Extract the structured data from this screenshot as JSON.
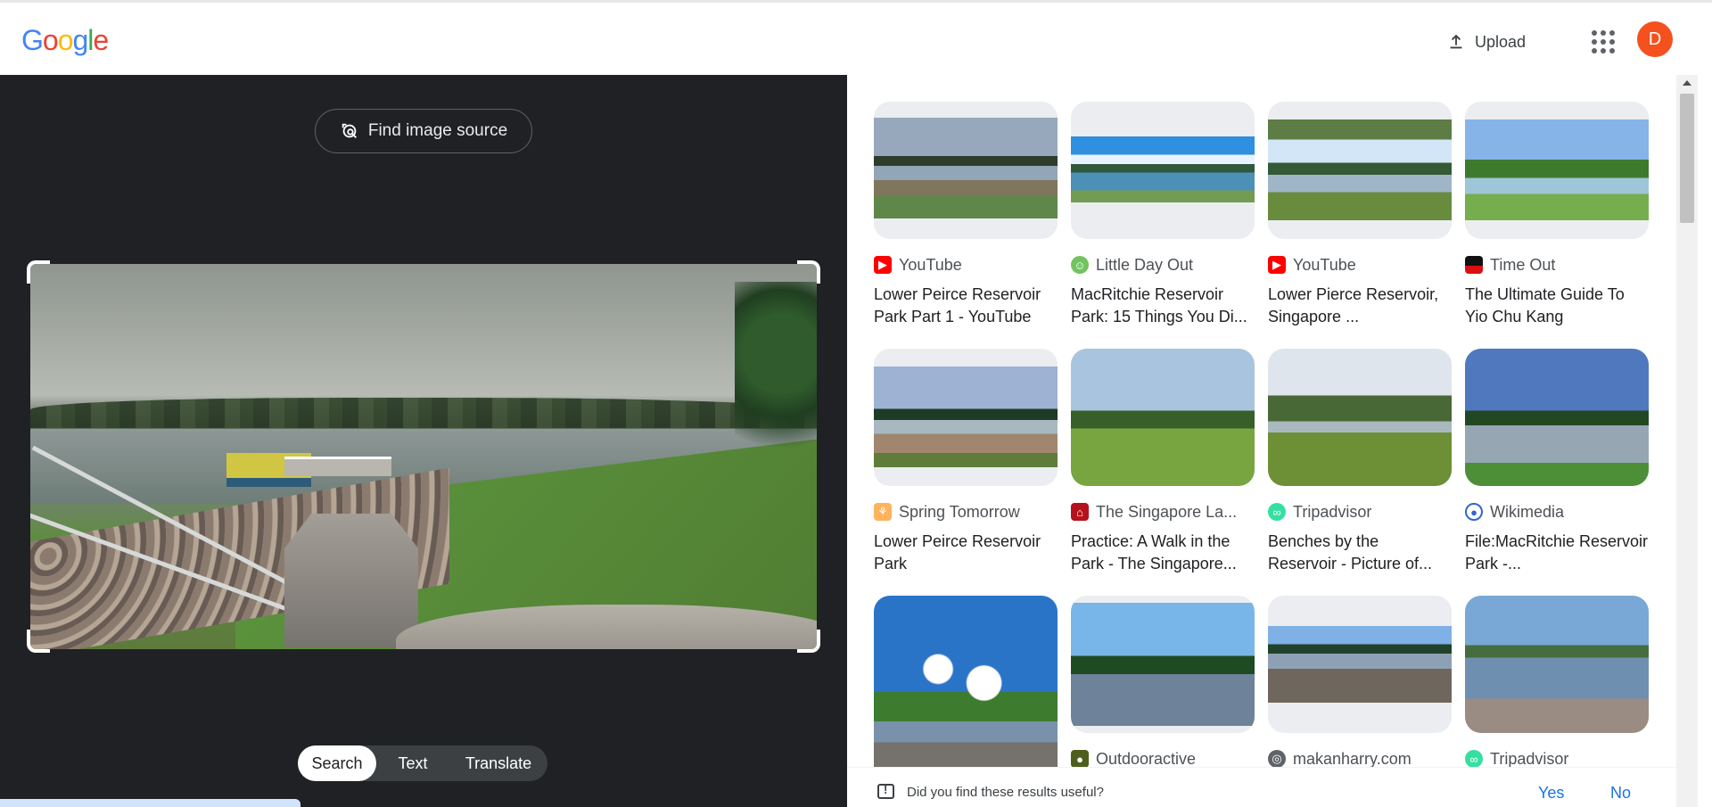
{
  "header": {
    "logo": "Google",
    "upload_label": "Upload",
    "avatar_initial": "D",
    "icons": {
      "upload": "upload-icon",
      "apps": "apps-grid-icon"
    }
  },
  "left_panel": {
    "find_source_label": "Find image source",
    "modes": [
      {
        "label": "Search",
        "active": true
      },
      {
        "label": "Text",
        "active": false
      },
      {
        "label": "Translate",
        "active": false
      }
    ]
  },
  "results": [
    {
      "source": "YouTube",
      "title": "Lower Peirce Reservoir Park Part 1 - YouTube",
      "favicon": "youtube-icon",
      "color": "#ff0000"
    },
    {
      "source": "Little Day Out",
      "title": "MacRitchie Reservoir Park: 15 Things You Di...",
      "favicon": "little-day-out-icon",
      "color": "#71c45f"
    },
    {
      "source": "YouTube",
      "title": "Lower Pierce Reservoir, Singapore ...",
      "favicon": "youtube-icon",
      "color": "#ff0000"
    },
    {
      "source": "Time Out",
      "title": "The Ultimate Guide To Yio Chu Kang",
      "favicon": "time-out-icon",
      "color": "#d90f15"
    },
    {
      "source": "Spring Tomorrow",
      "title": "Lower Peirce Reservoir Park",
      "favicon": "spring-tomorrow-icon",
      "color": "#ffb35c"
    },
    {
      "source": "The Singapore La...",
      "title": "Practice: A Walk in the Park - The Singapore...",
      "favicon": "singapore-icon",
      "color": "#b5121b"
    },
    {
      "source": "Tripadvisor",
      "title": "Benches by the Reservoir - Picture of...",
      "favicon": "tripadvisor-icon",
      "color": "#34e0a1"
    },
    {
      "source": "Wikimedia",
      "title": "File:MacRitchie Reservoir Park -...",
      "favicon": "wikimedia-icon",
      "color": "#3366cc"
    },
    {
      "source": "",
      "title": "",
      "favicon": "",
      "color": "#ffffff"
    },
    {
      "source": "Outdooractive",
      "title": "",
      "favicon": "outdooractive-icon",
      "color": "#4e5f1c"
    },
    {
      "source": "makanharry.com",
      "title": "",
      "favicon": "globe-icon",
      "color": "#5f6368"
    },
    {
      "source": "Tripadvisor",
      "title": "",
      "favicon": "tripadvisor-icon",
      "color": "#34e0a1"
    }
  ],
  "feedback": {
    "question": "Did you find these results useful?",
    "yes": "Yes",
    "no": "No"
  }
}
